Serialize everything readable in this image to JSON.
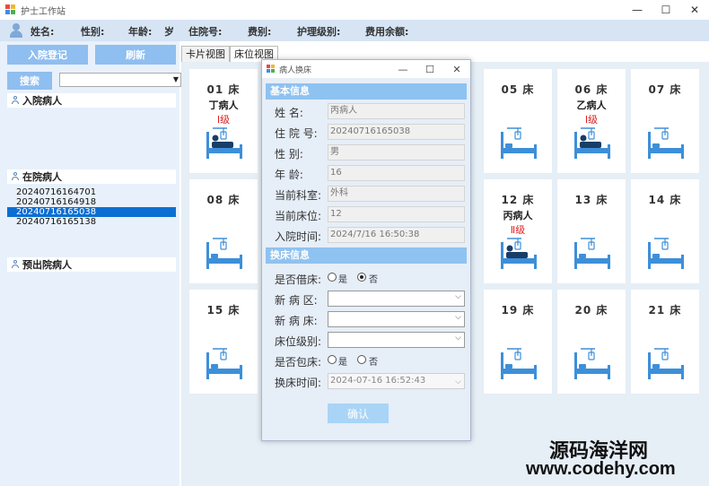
{
  "window": {
    "title": "护士工作站",
    "minimize": "—",
    "maximize": "☐",
    "close": "✕"
  },
  "infobar": {
    "name_label": "姓名:",
    "gender_label": "性别:",
    "age_label": "年龄:",
    "age_value": "岁",
    "admission_no_label": "住院号:",
    "fee_type_label": "费别:",
    "care_level_label": "护理级别:",
    "balance_label": "费用余额:"
  },
  "left": {
    "admit_button": "入院登记",
    "refresh_button": "刷新",
    "search_button": "搜索",
    "groups": {
      "admitting": "入院病人",
      "in_hospital": "在院病人",
      "discharging": "预出院病人"
    },
    "in_hospital_list": [
      "20240716164701",
      "20240716164918",
      "20240716165038",
      "20240716165138"
    ],
    "selected_index": 2
  },
  "tabs": [
    "卡片视图",
    "床位视图"
  ],
  "active_tab": 1,
  "beds": [
    {
      "no": "01 床",
      "patient": "丁病人",
      "level": "Ⅰ级",
      "occupied": true
    },
    {
      "no": "05 床",
      "patient": "",
      "level": "",
      "occupied": false
    },
    {
      "no": "06 床",
      "patient": "乙病人",
      "level": "Ⅰ级",
      "occupied": true
    },
    {
      "no": "07 床",
      "patient": "",
      "level": "",
      "occupied": false
    },
    {
      "no": "08 床",
      "patient": "",
      "level": "",
      "occupied": false
    },
    {
      "no": "12 床",
      "patient": "丙病人",
      "level": "Ⅱ级",
      "occupied": true
    },
    {
      "no": "13 床",
      "patient": "",
      "level": "",
      "occupied": false
    },
    {
      "no": "14 床",
      "patient": "",
      "level": "",
      "occupied": false
    },
    {
      "no": "15 床",
      "patient": "",
      "level": "",
      "occupied": false
    },
    {
      "no": "19 床",
      "patient": "",
      "level": "",
      "occupied": false
    },
    {
      "no": "20 床",
      "patient": "",
      "level": "",
      "occupied": false
    },
    {
      "no": "21 床",
      "patient": "",
      "level": "",
      "occupied": false
    }
  ],
  "dialog": {
    "title": "病人换床",
    "basic_section": "基本信息",
    "fields": [
      {
        "label": "姓    名:",
        "value": "丙病人"
      },
      {
        "label": "住 院 号:",
        "value": "20240716165038"
      },
      {
        "label": "性    别:",
        "value": "男"
      },
      {
        "label": "年    龄:",
        "value": "16"
      },
      {
        "label": "当前科室:",
        "value": "外科"
      },
      {
        "label": "当前床位:",
        "value": "12"
      },
      {
        "label": "入院时间:",
        "value": "2024/7/16 16:50:38"
      }
    ],
    "change_section": "换床信息",
    "borrow_label": "是否借床:",
    "borrow_yes": "是",
    "borrow_no": "否",
    "borrow_selected": "no",
    "new_ward_label": "新 病 区:",
    "new_bed_label": "新 病 床:",
    "bed_level_label": "床位级别:",
    "charter_label": "是否包床:",
    "charter_yes": "是",
    "charter_no": "否",
    "charter_selected": "none",
    "change_time_label": "换床时间:",
    "change_time_value": "2024-07-16 16:52:43",
    "confirm_button": "确认"
  },
  "watermark": {
    "line1": "源码海洋网",
    "line2": "www.codehy.com"
  },
  "colors": {
    "accent_blue": "#8fbef0",
    "selection": "#0b6fd2",
    "level_red": "#e02020",
    "bed_icon": "#3d8fd9"
  }
}
